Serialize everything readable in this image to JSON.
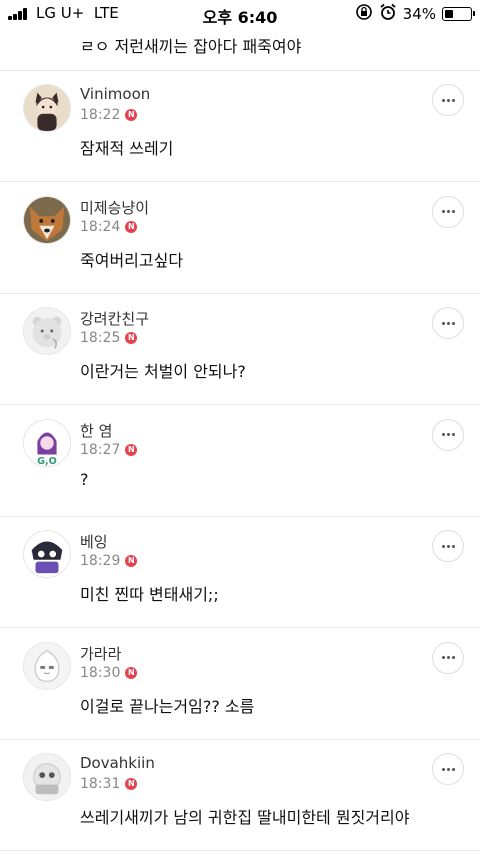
{
  "status_bar": {
    "carrier": "LG U+",
    "network": "LTE",
    "time": "오후 6:40",
    "battery_percent": "34%",
    "battery_level": 0.34,
    "icons": [
      "signal-icon",
      "rotation-lock-icon",
      "alarm-icon",
      "battery-icon"
    ]
  },
  "previous_comment": {
    "text": "ㄹㅇ 저런새끼는 잡아다 패죽여야"
  },
  "new_badge_label": "N",
  "comments": [
    {
      "nickname": "Vinimoon",
      "time": "18:22",
      "body": "잠재적 쓰레기",
      "avatar": "character-avatar-icon"
    },
    {
      "nickname": "미제승냥이",
      "time": "18:24",
      "body": "죽여버리고싶다",
      "avatar": "wolf-avatar-icon"
    },
    {
      "nickname": "강려칸친구",
      "time": "18:25",
      "body": "이란거는 처벌이 안되나?",
      "avatar": "default-bear-avatar-icon"
    },
    {
      "nickname": "한 염",
      "time": "18:27",
      "body": "?",
      "avatar": "purple-character-avatar-icon"
    },
    {
      "nickname": "베잉",
      "time": "18:29",
      "body": "미친 찐따 변태새기;;",
      "avatar": "cartoon-avatar-icon"
    },
    {
      "nickname": "가라라",
      "time": "18:30",
      "body": "이걸로 끝나는거임?? 소름",
      "avatar": "default-peach-avatar-icon"
    },
    {
      "nickname": "Dovahkiin",
      "time": "18:31",
      "body": "쓰레기새끼가 남의 귀한집 딸내미한테 뭔짓거리야",
      "avatar": "default-avatar-icon"
    }
  ],
  "colors": {
    "new_badge": "#e8424f",
    "time_text": "#888888",
    "divider": "#e8e8e8"
  }
}
